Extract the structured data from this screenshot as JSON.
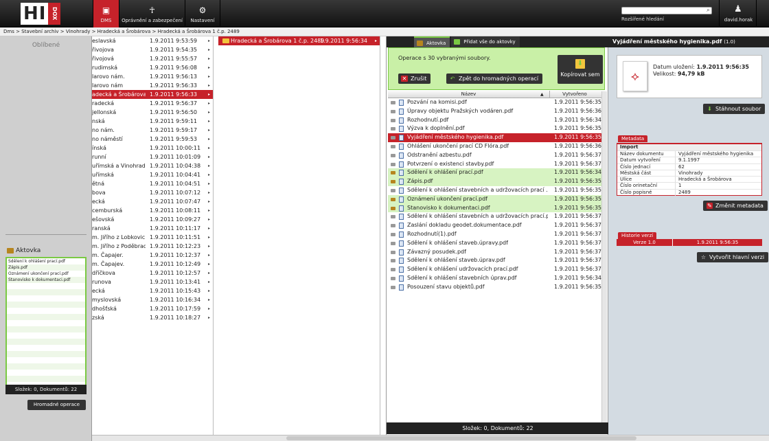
{
  "app": {
    "logo_text": "HI",
    "logo_sub": "DOX"
  },
  "nav": [
    {
      "label": "DMS",
      "icon": "dms-icon",
      "active": true
    },
    {
      "label": "Oprávnění a zabezpečení",
      "icon": "security-icon"
    },
    {
      "label": "Nastavení",
      "icon": "settings-icon"
    }
  ],
  "search": {
    "placeholder": "",
    "advanced_label": "Rozšířené hledání"
  },
  "user": {
    "name": "david.horak"
  },
  "breadcrumb": "Dms > Stavební archiv > Vinohrady > Hradecká a Šrobárova > Hradecká a Šrobárova 1 č.p. 2489",
  "left": {
    "favorites_label": "Oblíbené",
    "aktovka_label": "Aktovka",
    "aktovka_items": [
      "Sdělení k ohlášení prací.pdf",
      "Zápis.pdf",
      "Oznámení ukončení prací.pdf",
      "Stanovisko k dokumentaci.pdf",
      "",
      "",
      "",
      "",
      "",
      "",
      "",
      "",
      "",
      "",
      "",
      "",
      "",
      "",
      "",
      ""
    ],
    "aktovka_footer": "Složek: 0, Dokumentů: 22",
    "bulk_button": "Hromadné operace"
  },
  "col1": [
    {
      "name": "eslavská",
      "date": "1.9.2011 9:53:59"
    },
    {
      "name": "řivojova",
      "date": "1.9.2011 9:54:35"
    },
    {
      "name": "řivojová",
      "date": "1.9.2011 9:55:57"
    },
    {
      "name": "rudimská",
      "date": "1.9.2011 9:56:08"
    },
    {
      "name": "larovo nám.",
      "date": "1.9.2011 9:56:13"
    },
    {
      "name": "larovo nám",
      "date": "1.9.2011 9:56:33"
    },
    {
      "name": "adecká a Šrobárova",
      "date": "1.9.2011 9:56:33",
      "selected": true
    },
    {
      "name": "radecká",
      "date": "1.9.2011 9:56:37"
    },
    {
      "name": "jellonská",
      "date": "1.9.2011 9:56:50"
    },
    {
      "name": "nská",
      "date": "1.9.2011 9:59:11"
    },
    {
      "name": "no nám.",
      "date": "1.9.2011 9:59:17"
    },
    {
      "name": "no náměstí",
      "date": "1.9.2011 9:59:53"
    },
    {
      "name": "ínská",
      "date": "1.9.2011 10:00:11"
    },
    {
      "name": "runní",
      "date": "1.9.2011 10:01:09"
    },
    {
      "name": "uřímská a Vinohradská",
      "date": "1.9.2011 10:04:38"
    },
    {
      "name": "uřímská",
      "date": "1.9.2011 10:04:41"
    },
    {
      "name": "ětná",
      "date": "1.9.2011 10:04:51"
    },
    {
      "name": "bova",
      "date": "1.9.2011 10:07:12"
    },
    {
      "name": "ecká",
      "date": "1.9.2011 10:07:47"
    },
    {
      "name": "cemburská",
      "date": "1.9.2011 10:08:11"
    },
    {
      "name": "ešovská",
      "date": "1.9.2011 10:09:27"
    },
    {
      "name": "ranská",
      "date": "1.9.2011 10:11:17"
    },
    {
      "name": "m. Jiřího z Lobkovic",
      "date": "1.9.2011 10:11:51"
    },
    {
      "name": "m. Jiřího z Poděbrad",
      "date": "1.9.2011 10:12:23"
    },
    {
      "name": "m. Čapajer.",
      "date": "1.9.2011 10:12:37"
    },
    {
      "name": "m. Čapajev.",
      "date": "1.9.2011 10:12:49"
    },
    {
      "name": "dříčkova",
      "date": "1.9.2011 10:12:57"
    },
    {
      "name": "runova",
      "date": "1.9.2011 10:13:41"
    },
    {
      "name": "ecká",
      "date": "1.9.2011 10:15:43"
    },
    {
      "name": "myslovská",
      "date": "1.9.2011 10:16:34"
    },
    {
      "name": "dhošťská",
      "date": "1.9.2011 10:17:59"
    },
    {
      "name": "zská",
      "date": "1.9.2011 10:18:27"
    }
  ],
  "col2": [
    {
      "name": "Hradecká a Šrobárova 1 č.p. 2489",
      "date": "1.9.2011 9:56:34",
      "selected": true
    }
  ],
  "middle": {
    "tabs": [
      {
        "label": "Aktovka",
        "active": true
      },
      {
        "label": "Přidat vše do aktovky"
      }
    ],
    "ops_text": "Operace s 30 vybranými soubory.",
    "cancel_label": "Zrušit",
    "back_label": "Zpět do hromadných operací",
    "copy_label": "Kopírovat sem",
    "col_name": "Název",
    "col_created": "Vytvořeno",
    "files": [
      {
        "name": "Pozvání na komisi.pdf",
        "date": "1.9.2011 9:56:35"
      },
      {
        "name": "Úpravy objektu Pražských vodáren.pdf",
        "date": "1.9.2011 9:56:36"
      },
      {
        "name": "Rozhodnutí.pdf",
        "date": "1.9.2011 9:56:34"
      },
      {
        "name": "Výzva k doplnění.pdf",
        "date": "1.9.2011 9:56:35"
      },
      {
        "name": "Vyjádření městského hygienika.pdf",
        "date": "1.9.2011 9:56:35",
        "state": "sel"
      },
      {
        "name": "Ohlášení ukončení prací CD Flóra.pdf",
        "date": "1.9.2011 9:56:36"
      },
      {
        "name": "Odstranění azbestu.pdf",
        "date": "1.9.2011 9:56:37"
      },
      {
        "name": "Potvrzení o existenci stavby.pdf",
        "date": "1.9.2011 9:56:37"
      },
      {
        "name": "Sdělení k ohlášení prací.pdf",
        "date": "1.9.2011 9:56:34",
        "state": "g"
      },
      {
        "name": "Zápis.pdf",
        "date": "1.9.2011 9:56:35",
        "state": "g"
      },
      {
        "name": "Sdělení k ohlášení stavebních a udržovacích prací          .pdf",
        "date": "1.9.2011 9:56:35"
      },
      {
        "name": "Oznámení ukončení prací.pdf",
        "date": "1.9.2011 9:56:35",
        "state": "g"
      },
      {
        "name": "Stanovisko k dokumentaci.pdf",
        "date": "1.9.2011 9:56:35",
        "state": "g"
      },
      {
        "name": "Sdělení k ohlášení stavebních a udržovacích prací.pdf",
        "date": "1.9.2011 9:56:37"
      },
      {
        "name": "Zaslání dokladu geodet.dokumentace.pdf",
        "date": "1.9.2011 9:56:37"
      },
      {
        "name": "Rozhodnutí(1).pdf",
        "date": "1.9.2011 9:56:37"
      },
      {
        "name": "Sdělení k ohlášení staveb.úpravy.pdf",
        "date": "1.9.2011 9:56:37"
      },
      {
        "name": "Závazný posudek.pdf",
        "date": "1.9.2011 9:56:37"
      },
      {
        "name": "Sdělení k ohlášení staveb.úprav.pdf",
        "date": "1.9.2011 9:56:37"
      },
      {
        "name": "Sdělení k ohlášení udržovacích prací.pdf",
        "date": "1.9.2011 9:56:37"
      },
      {
        "name": "Sdělení k ohlášení stavebních úprav.pdf",
        "date": "1.9.2011 9:56:34"
      },
      {
        "name": "Posouzení stavu objektů.pdf",
        "date": "1.9.2011 9:56:35"
      }
    ],
    "footer": "Složek: 0, Dokumentů: 22"
  },
  "right": {
    "title": "Vyjádření městského hygienika.pdf",
    "version": "(1.0)",
    "saved_label": "Datum uložení:",
    "saved_value": "1.9.2011 9:56:35",
    "size_label": "Velikost:",
    "size_value": "94,79 kB",
    "download_label": "Stáhnout soubor",
    "metadata_tab": "Metadata",
    "meta_group": "Import",
    "meta": [
      {
        "k": "Název dokumentu",
        "v": "Vyjádření městského hygienika"
      },
      {
        "k": "Datum vytvoření",
        "v": "9.1.1997"
      },
      {
        "k": "Číslo jednací",
        "v": "62"
      },
      {
        "k": "Městská část",
        "v": "Vinohrady"
      },
      {
        "k": "Ulice",
        "v": "Hradecká a Šrobárova"
      },
      {
        "k": "Číslo orinetační",
        "v": "1"
      },
      {
        "k": "Číslo popisné",
        "v": "2489"
      }
    ],
    "change_meta_label": "Změnit metadata",
    "history_tab": "Historie verzí",
    "history": {
      "version": "Verze 1.0",
      "date": "1.9.2011 9:56:35"
    },
    "create_version_label": "Vytvořit hlavní verzi"
  }
}
